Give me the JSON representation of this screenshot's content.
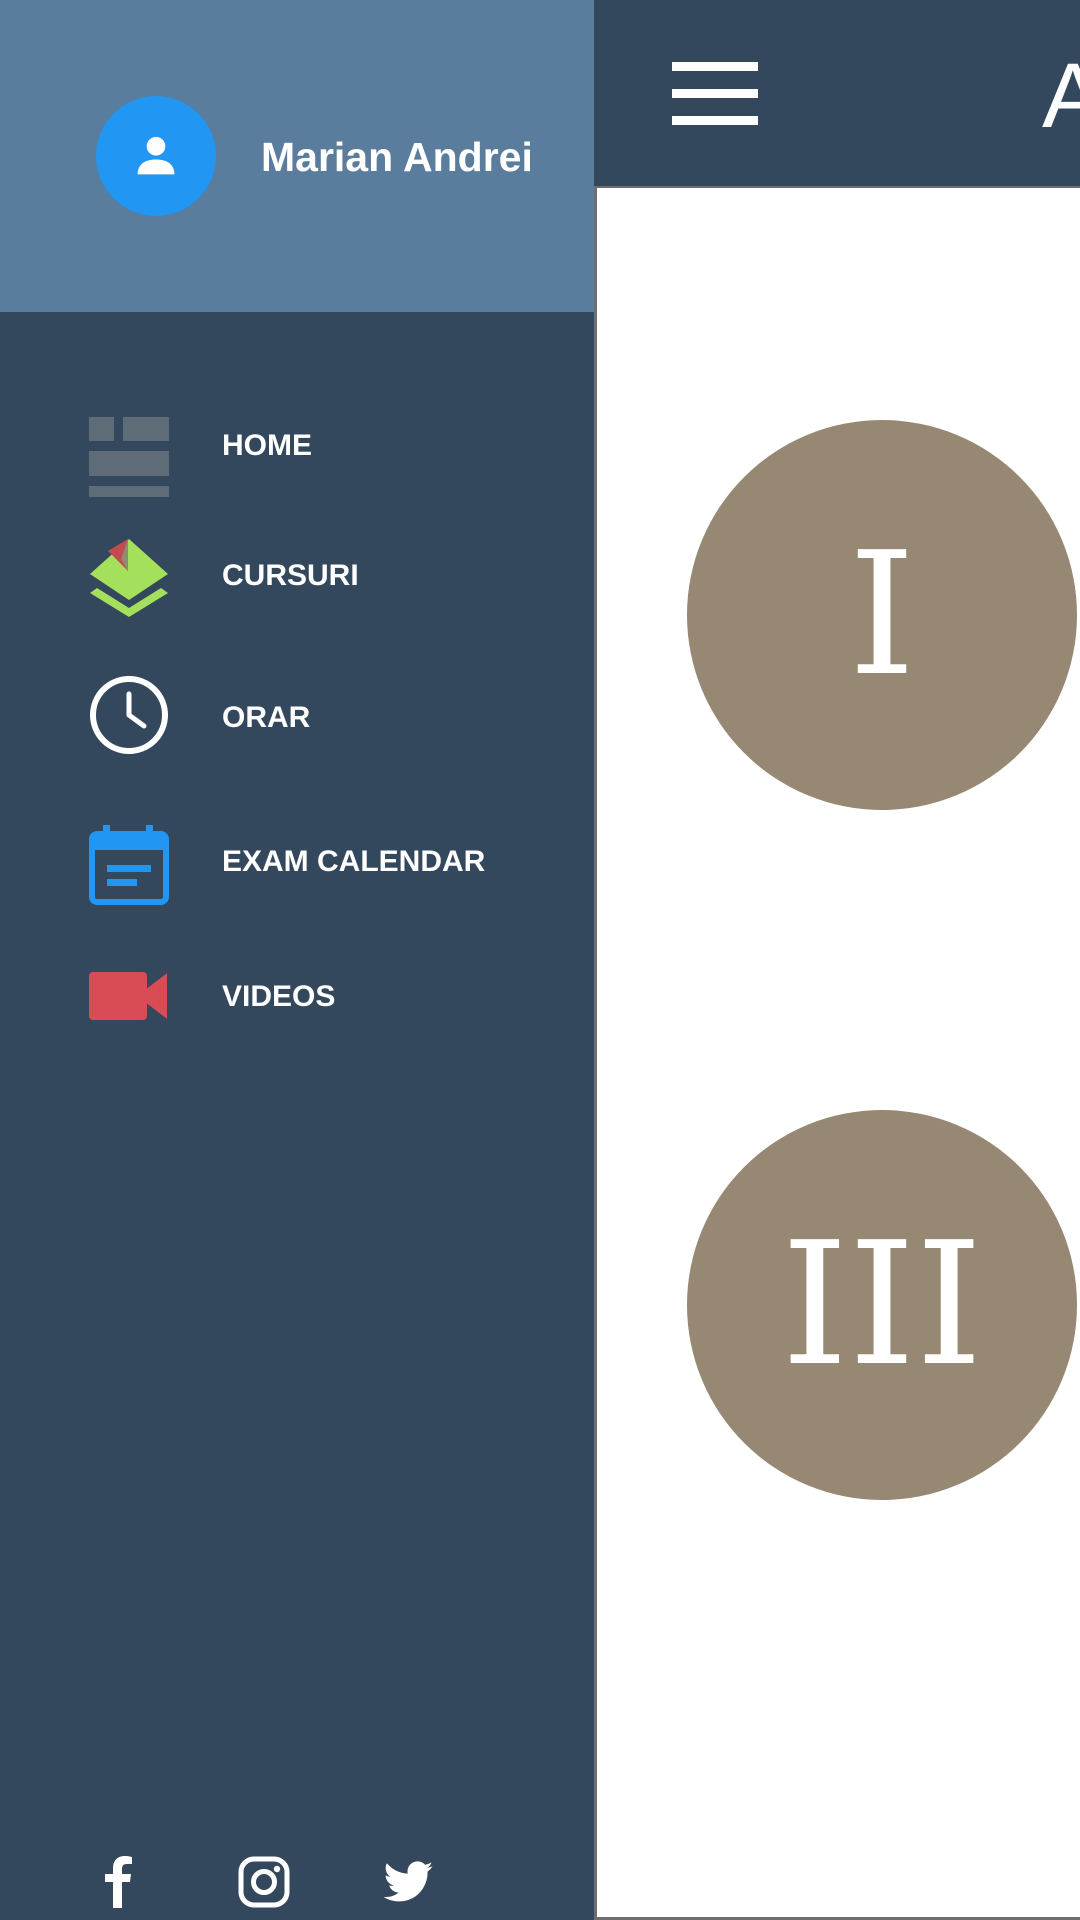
{
  "drawer": {
    "user_name": "Marian Andrei",
    "items": [
      {
        "label": "HOME",
        "icon": "dashboard-icon"
      },
      {
        "label": "CURSURI",
        "icon": "layers-icon"
      },
      {
        "label": "ORAR",
        "icon": "clock-icon"
      },
      {
        "label": "EXAM CALENDAR",
        "icon": "calendar-icon"
      },
      {
        "label": "VIDEOS",
        "icon": "video-camera-icon"
      }
    ],
    "social": [
      "facebook-icon",
      "instagram-icon",
      "twitter-icon"
    ]
  },
  "appbar": {
    "title": "A"
  },
  "main": {
    "years": [
      "I",
      "III"
    ]
  },
  "colors": {
    "drawer_bg": "#33485c",
    "header_bg": "#5a7d9d",
    "avatar": "#2196f3",
    "circle": "#968873",
    "layers_green": "#a5e05c",
    "calendar_blue": "#2196f3",
    "video_red": "#d94b55"
  }
}
